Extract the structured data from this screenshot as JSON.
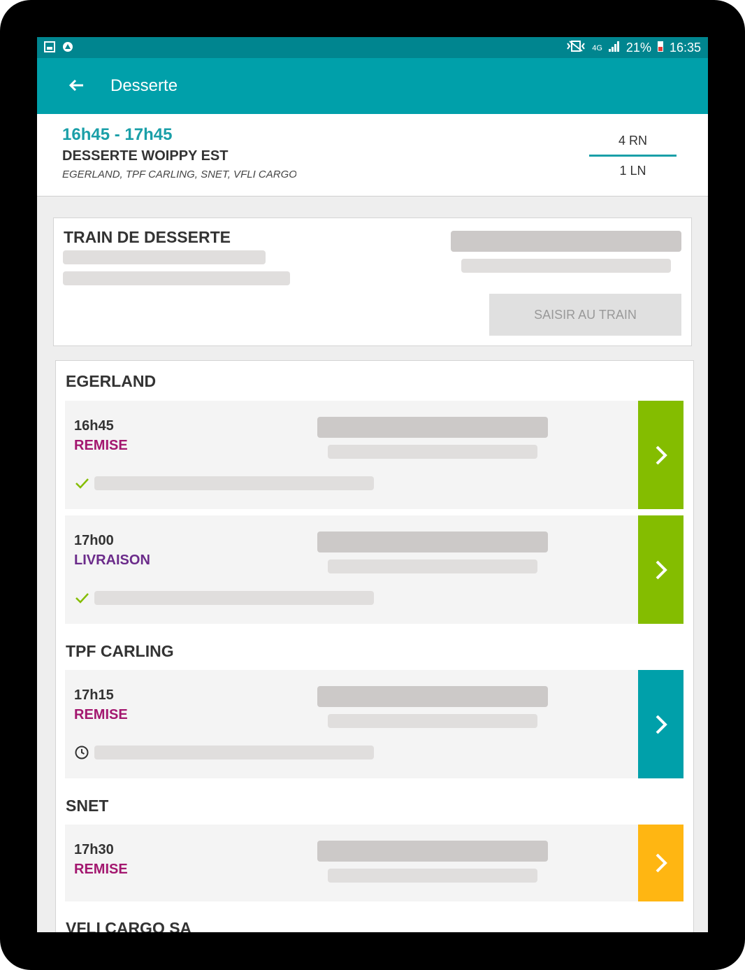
{
  "status_bar": {
    "battery": "21%",
    "time": "16:35",
    "network": "4G",
    "icons": [
      "image-icon",
      "notification-icon",
      "vibrate-icon",
      "signal-icon",
      "battery-icon"
    ]
  },
  "app_bar": {
    "title": "Desserte",
    "back_icon": "back-arrow-icon",
    "color": "#00a0aa"
  },
  "header": {
    "time_range": "16h45 - 17h45",
    "title": "DESSERTE WOIPPY EST",
    "subtitle": "EGERLAND, TPF CARLING, SNET, VFLI CARGO SA",
    "count_top": "4 RN",
    "count_bottom": "1 LN"
  },
  "train": {
    "title": "TRAIN DE DESSERTE",
    "button_label": "SAISIR AU TRAIN"
  },
  "sections": [
    {
      "name": "EGERLAND",
      "stops": [
        {
          "time": "16h45",
          "type": "REMISE",
          "type_color": "#a3176f",
          "status_icon": "check-icon",
          "arrow_color": "#84bd00"
        },
        {
          "time": "17h00",
          "type": "LIVRAISON",
          "type_color": "#6b2b8a",
          "status_icon": "check-icon",
          "arrow_color": "#84bd00"
        }
      ]
    },
    {
      "name": "TPF CARLING",
      "stops": [
        {
          "time": "17h15",
          "type": "REMISE",
          "type_color": "#a3176f",
          "status_icon": "clock-icon",
          "arrow_color": "#00a0aa"
        }
      ]
    },
    {
      "name": "SNET",
      "stops": [
        {
          "time": "17h30",
          "type": "REMISE",
          "type_color": "#a3176f",
          "status_icon": "",
          "arrow_color": "#ffb612"
        }
      ]
    },
    {
      "name": "VFLI CARGO SA",
      "stops": []
    }
  ]
}
